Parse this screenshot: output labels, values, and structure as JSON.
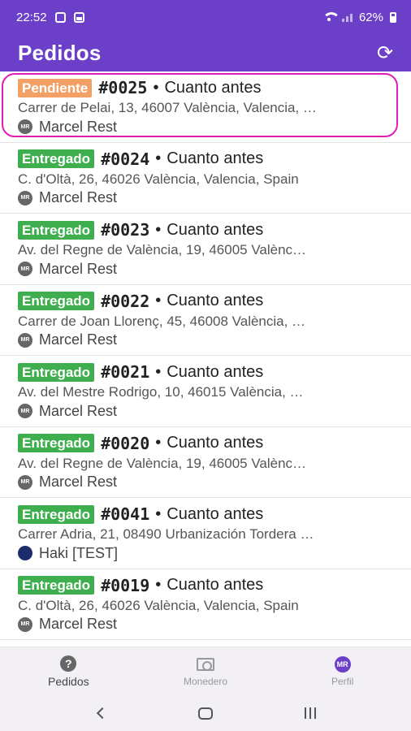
{
  "status_bar": {
    "time": "22:52",
    "battery": "62%"
  },
  "app_bar": {
    "title": "Pedidos",
    "refresh_icon": "refresh-icon"
  },
  "colors": {
    "primary": "#6c3fc9",
    "pending": "#f2a065",
    "delivered": "#3fae4f",
    "highlight": "#e21bb5"
  },
  "orders": [
    {
      "status": "Pendiente",
      "number": "#0025",
      "timing": "Cuanto antes",
      "address": "Carrer de Pelai, 13, 46007 València, Valencia, …",
      "restaurant": "Marcel Rest",
      "avatar": "MR"
    },
    {
      "status": "Entregado",
      "number": "#0024",
      "timing": "Cuanto antes",
      "address": "C. d'Oltà, 26, 46026 València, Valencia, Spain",
      "restaurant": "Marcel Rest",
      "avatar": "MR"
    },
    {
      "status": "Entregado",
      "number": "#0023",
      "timing": "Cuanto antes",
      "address": "Av. del Regne de València, 19, 46005 Valènc…",
      "restaurant": "Marcel Rest",
      "avatar": "MR"
    },
    {
      "status": "Entregado",
      "number": "#0022",
      "timing": "Cuanto antes",
      "address": "Carrer de Joan Llorenç, 45, 46008 València, …",
      "restaurant": "Marcel Rest",
      "avatar": "MR"
    },
    {
      "status": "Entregado",
      "number": "#0021",
      "timing": "Cuanto antes",
      "address": "Av. del Mestre Rodrigo, 10, 46015 València, …",
      "restaurant": "Marcel Rest",
      "avatar": "MR"
    },
    {
      "status": "Entregado",
      "number": "#0020",
      "timing": "Cuanto antes",
      "address": "Av. del Regne de València, 19, 46005 Valènc…",
      "restaurant": "Marcel Rest",
      "avatar": "MR"
    },
    {
      "status": "Entregado",
      "number": "#0041",
      "timing": "Cuanto antes",
      "address": "Carrer Adria, 21, 08490 Urbanización Tordera …",
      "restaurant": "Haki [TEST]",
      "avatar": ""
    },
    {
      "status": "Entregado",
      "number": "#0019",
      "timing": "Cuanto antes",
      "address": "C. d'Oltà, 26, 46026 València, Valencia, Spain",
      "restaurant": "Marcel Rest",
      "avatar": "MR"
    }
  ],
  "separator": "•",
  "bottom_nav": {
    "items": [
      {
        "label": "Pedidos",
        "icon": "help-icon"
      },
      {
        "label": "Monedero",
        "icon": "wallet-icon"
      },
      {
        "label": "Perfil",
        "icon": "avatar",
        "avatar": "MR"
      }
    ]
  }
}
